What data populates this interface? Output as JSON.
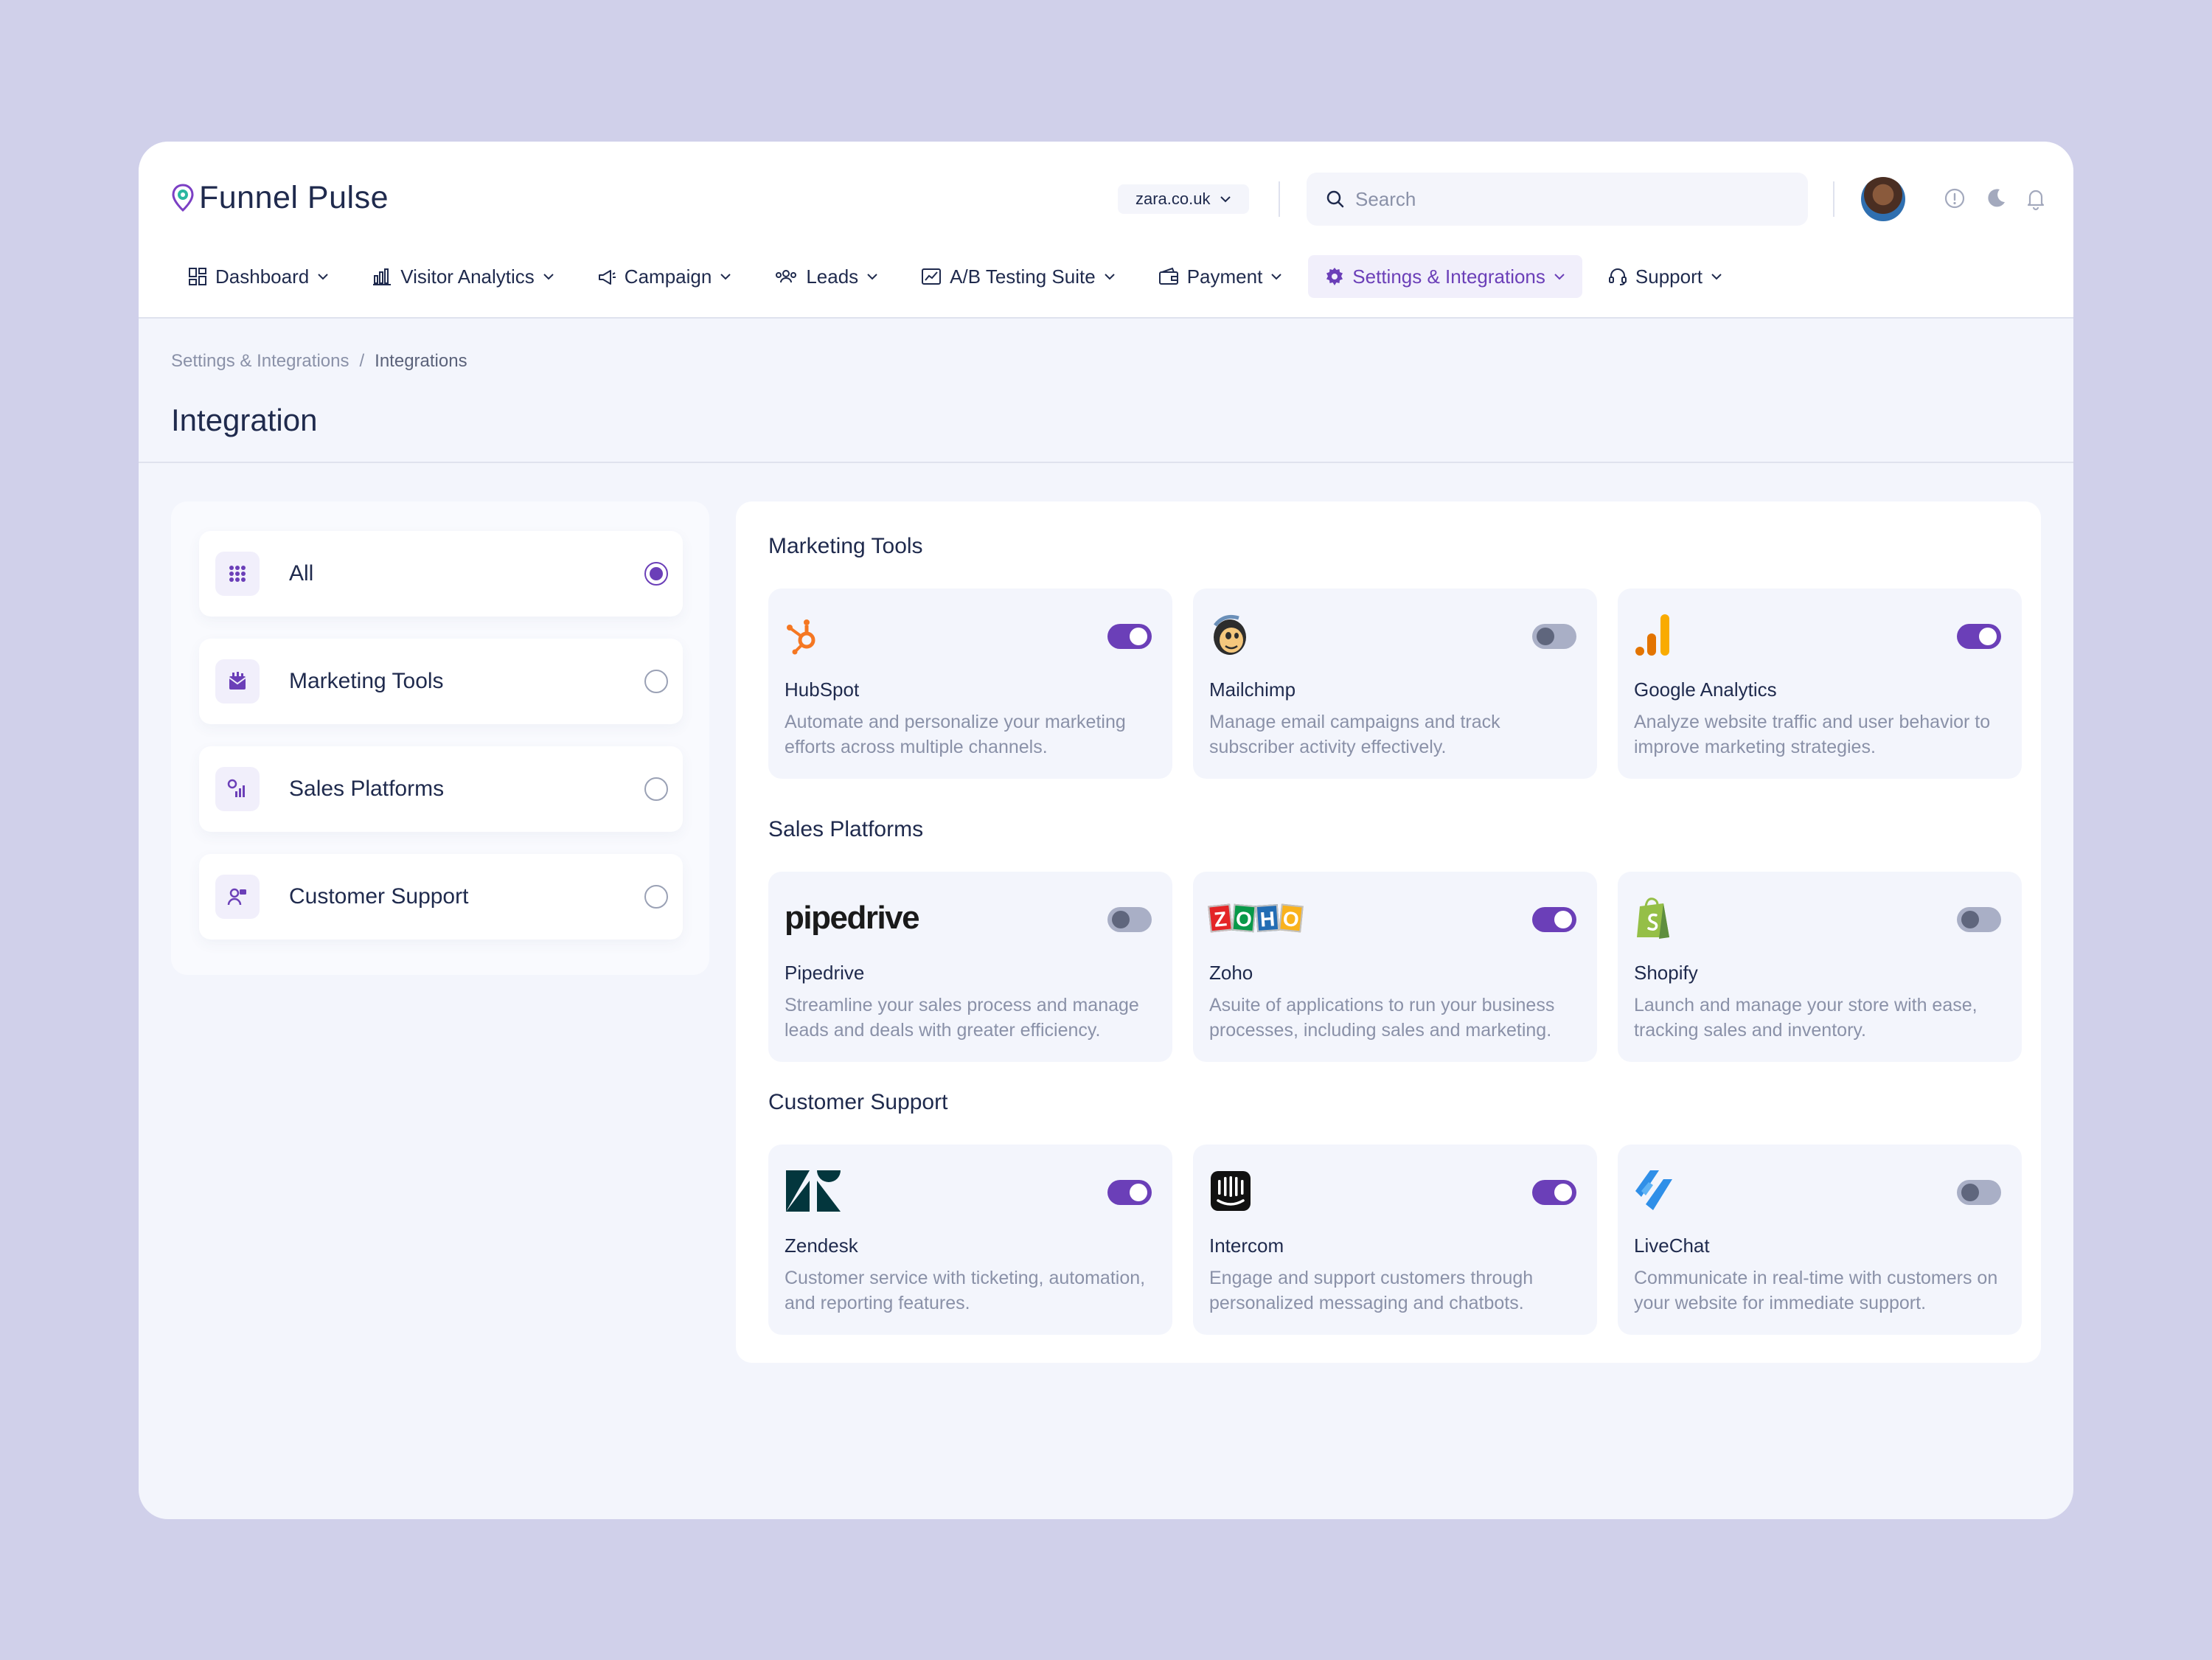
{
  "app": {
    "name": "Funnel Pulse"
  },
  "header": {
    "domain": "zara.co.uk",
    "search_placeholder": "Search"
  },
  "nav": [
    {
      "label": "Dashboard",
      "icon": "dashboard-icon"
    },
    {
      "label": "Visitor Analytics",
      "icon": "bar-chart-icon"
    },
    {
      "label": "Campaign",
      "icon": "megaphone-icon"
    },
    {
      "label": "Leads",
      "icon": "users-icon"
    },
    {
      "label": "A/B Testing Suite",
      "icon": "ab-testing-icon"
    },
    {
      "label": "Payment",
      "icon": "wallet-icon"
    },
    {
      "label": "Settings & Integrations",
      "icon": "gear-icon",
      "active": true
    },
    {
      "label": "Support",
      "icon": "headset-icon"
    }
  ],
  "breadcrumb": {
    "parent": "Settings & Integrations",
    "separator": "/",
    "current": "Integrations"
  },
  "page_title": "Integration",
  "filters": [
    {
      "label": "All",
      "selected": true
    },
    {
      "label": "Marketing Tools",
      "selected": false
    },
    {
      "label": "Sales Platforms",
      "selected": false
    },
    {
      "label": "Customer Support",
      "selected": false
    }
  ],
  "sections": [
    {
      "title": "Marketing Tools",
      "items": [
        {
          "name": "HubSpot",
          "desc": "Automate and personalize your marketing efforts across multiple channels.",
          "enabled": true,
          "logo": "hubspot-logo"
        },
        {
          "name": "Mailchimp",
          "desc": "Manage email campaigns and track subscriber activity effectively.",
          "enabled": false,
          "logo": "mailchimp-logo"
        },
        {
          "name": "Google Analytics",
          "desc": "Analyze website traffic and user behavior to improve marketing strategies.",
          "enabled": true,
          "logo": "google-analytics-logo"
        }
      ]
    },
    {
      "title": "Sales Platforms",
      "items": [
        {
          "name": "Pipedrive",
          "desc": "Streamline your sales process and manage leads and deals with greater efficiency.",
          "enabled": false,
          "logo": "pipedrive-logo",
          "logo_text": "pipedrive"
        },
        {
          "name": "Zoho",
          "desc": "Asuite of applications to run your business processes, including sales and marketing.",
          "enabled": true,
          "logo": "zoho-logo",
          "logo_letters": [
            "Z",
            "O",
            "H",
            "O"
          ]
        },
        {
          "name": "Shopify",
          "desc": "Launch and manage your store with ease, tracking sales and inventory.",
          "enabled": false,
          "logo": "shopify-logo"
        }
      ]
    },
    {
      "title": "Customer Support",
      "items": [
        {
          "name": "Zendesk",
          "desc": "Customer service with ticketing, automation, and reporting features.",
          "enabled": true,
          "logo": "zendesk-logo"
        },
        {
          "name": "Intercom",
          "desc": "Engage and support customers through personalized messaging and chatbots.",
          "enabled": true,
          "logo": "intercom-logo"
        },
        {
          "name": "LiveChat",
          "desc": "Communicate in real-time with customers on your website for immediate support.",
          "enabled": false,
          "logo": "livechat-logo"
        }
      ]
    }
  ],
  "colors": {
    "accent": "#6b3fb8",
    "toggle_off": "#a9afc6",
    "background": "#d0d0ea",
    "text": "#1f2a4d",
    "muted": "#8a91a8"
  }
}
